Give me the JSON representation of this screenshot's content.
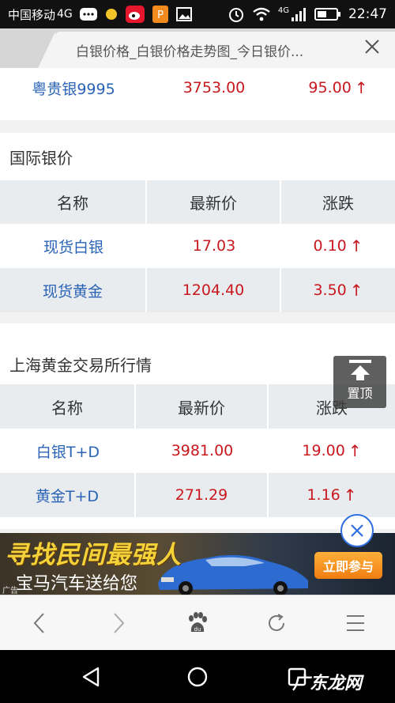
{
  "status_bar": {
    "carrier": "中国移动",
    "network": "4G",
    "signal_network": "4G",
    "time": "22:47",
    "icons": [
      "message-icon",
      "dot-icon",
      "weibo-icon",
      "app-icon",
      "image-icon",
      "alarm-icon",
      "wifi-icon",
      "signal-icon",
      "battery-icon"
    ]
  },
  "tab": {
    "title": "白银价格_白银价格走势图_今日银价..."
  },
  "top_row": {
    "name": "粤贵银9995",
    "price": "3753.00",
    "change": "95.00"
  },
  "international": {
    "title": "国际银价",
    "headers": [
      "名称",
      "最新价",
      "涨跌"
    ],
    "rows": [
      {
        "name": "现货白银",
        "price": "17.03",
        "change": "0.10"
      },
      {
        "name": "现货黄金",
        "price": "1204.40",
        "change": "3.50"
      }
    ]
  },
  "shanghai": {
    "title": "上海黄金交易所行情",
    "headers": [
      "名称",
      "最新价",
      "涨跌"
    ],
    "rows": [
      {
        "name": "白银T+D",
        "price": "3981.00",
        "change": "19.00"
      },
      {
        "name": "黄金T+D",
        "price": "271.29",
        "change": "1.16"
      }
    ]
  },
  "up_arrow": "↑",
  "back_to_top": {
    "label": "置顶"
  },
  "ad": {
    "headline": "寻找民间最强人",
    "subline": "宝马汽车送给您",
    "cta": "立即参与",
    "mark": "广告"
  },
  "toolbar": [
    "back-icon",
    "forward-icon",
    "baidu-home-icon",
    "refresh-icon",
    "menu-icon"
  ],
  "watermark": "广东龙网",
  "colors": {
    "name_blue": "#2a63b6",
    "value_red": "#c9171e",
    "header_bg": "#e9ecef",
    "ad_cta": "#f07d10"
  }
}
